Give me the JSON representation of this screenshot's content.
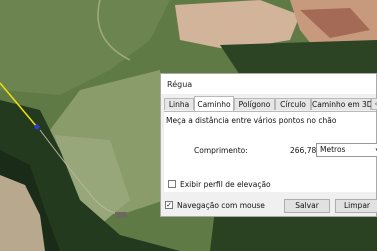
{
  "dialog": {
    "title": "Régua",
    "tabs": [
      {
        "label": "Linha",
        "active": false
      },
      {
        "label": "Caminho",
        "active": true
      },
      {
        "label": "Polígono",
        "active": false
      },
      {
        "label": "Círculo",
        "active": false
      },
      {
        "label": "Caminho em 3D",
        "active": false
      }
    ],
    "tab_scroll_icon": "chevron-left-icon",
    "description": "Meça a distância entre vários pontos no chão",
    "length_label": "Comprimento:",
    "length_value": "266,78",
    "unit_selected": "Metros",
    "elevation_profile_label": "Exibir perfil de elevação",
    "elevation_profile_checked": false,
    "mouse_navigation_label": "Navegação com mouse",
    "mouse_navigation_checked": true,
    "save_label": "Salvar",
    "clear_label": "Limpar"
  },
  "map": {
    "path_color": "#f0e010",
    "vertex_color": "#2a3fd8"
  }
}
